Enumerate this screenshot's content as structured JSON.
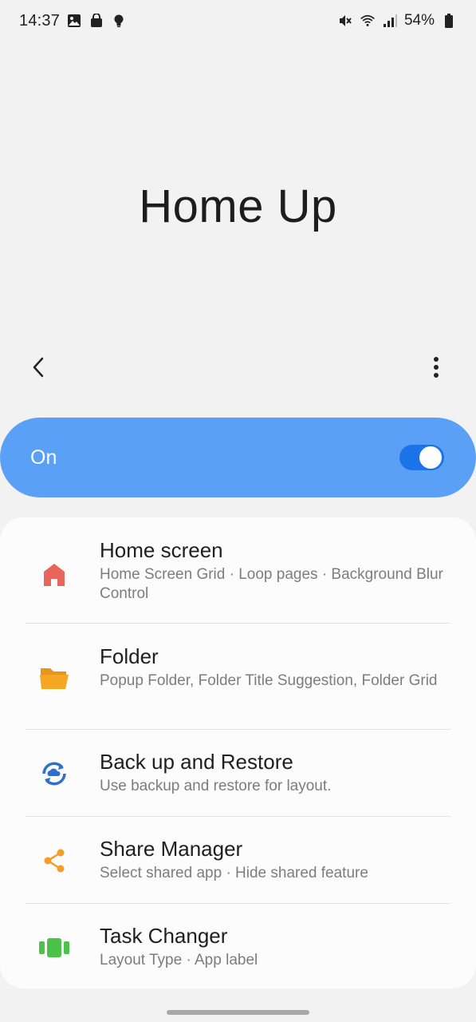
{
  "status_bar": {
    "time": "14:37",
    "left_icons": [
      "gallery-icon",
      "shopping-bag-icon",
      "lightbulb-icon"
    ],
    "right_icons": [
      "mute-icon",
      "wifi-icon",
      "signal-icon",
      "battery-icon"
    ],
    "battery_percent": "54%"
  },
  "header": {
    "title": "Home Up"
  },
  "toolbar": {
    "back_icon": "chevron-left-icon",
    "more_icon": "more-vertical-icon"
  },
  "master_switch": {
    "label": "On",
    "state": true,
    "accent_color": "#5ba0f7"
  },
  "items": [
    {
      "title": "Home screen",
      "subtitle": "Home Screen Grid · Loop pages · Background Blur Control",
      "icon": "home-icon",
      "icon_color": "#e8655a"
    },
    {
      "title": "Folder",
      "subtitle": "Popup Folder, Folder Title Suggestion, Folder Grid",
      "icon": "folder-icon",
      "icon_color": "#f5a623"
    },
    {
      "title": "Back up and Restore",
      "subtitle": "Use backup and restore for layout.",
      "icon": "backup-restore-icon",
      "icon_color": "#2f6fd1"
    },
    {
      "title": "Share Manager",
      "subtitle": "Select shared app · Hide shared feature",
      "icon": "share-icon",
      "icon_color": "#f39c2b"
    },
    {
      "title": "Task Changer",
      "subtitle": "Layout Type · App label",
      "icon": "task-changer-icon",
      "icon_color": "#4cc24a"
    }
  ]
}
